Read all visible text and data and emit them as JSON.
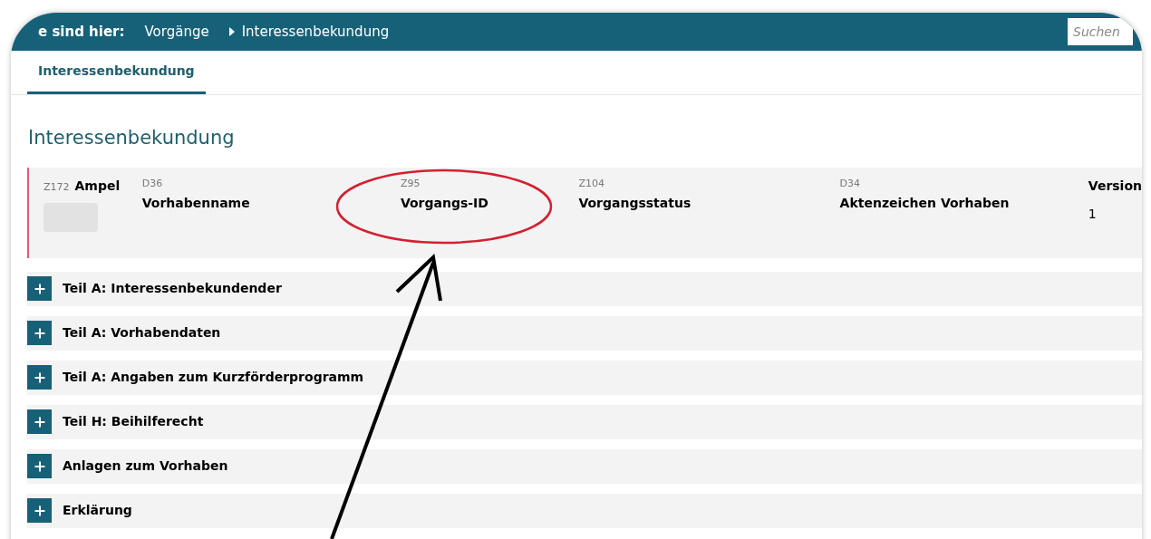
{
  "breadcrumb": {
    "label": "e sind hier:",
    "items": [
      {
        "text": "Vorgänge"
      },
      {
        "text": "Interessenbekundung"
      }
    ]
  },
  "search": {
    "placeholder": "Suchen"
  },
  "tabs": [
    {
      "label": "Interessenbekundung",
      "selected": true
    }
  ],
  "heading": "Interessenbekundung",
  "summary": {
    "code": "Z172",
    "title": "Ampel",
    "fields": [
      {
        "code": "D36",
        "label": "Vorhabenname"
      },
      {
        "code": "Z95",
        "label": "Vorgangs-ID"
      },
      {
        "code": "Z104",
        "label": "Vorgangsstatus"
      },
      {
        "code": "D34",
        "label": "Aktenzeichen Vorhaben"
      }
    ],
    "version": {
      "label": "Version",
      "value": "1"
    }
  },
  "sections": [
    {
      "title": "Teil A: Interessenbekundender",
      "expanded": false
    },
    {
      "title": "Teil A: Vorhabendaten",
      "expanded": false
    },
    {
      "title": "Teil A: Angaben zum Kurzförderprogramm",
      "expanded": false
    },
    {
      "title": "Teil H: Beihilferecht",
      "expanded": false
    },
    {
      "title": "Anlagen zum Vorhaben",
      "expanded": false
    },
    {
      "title": "Erklärung",
      "expanded": false
    }
  ],
  "annotation": {
    "ellipse": true,
    "arrow": true
  }
}
